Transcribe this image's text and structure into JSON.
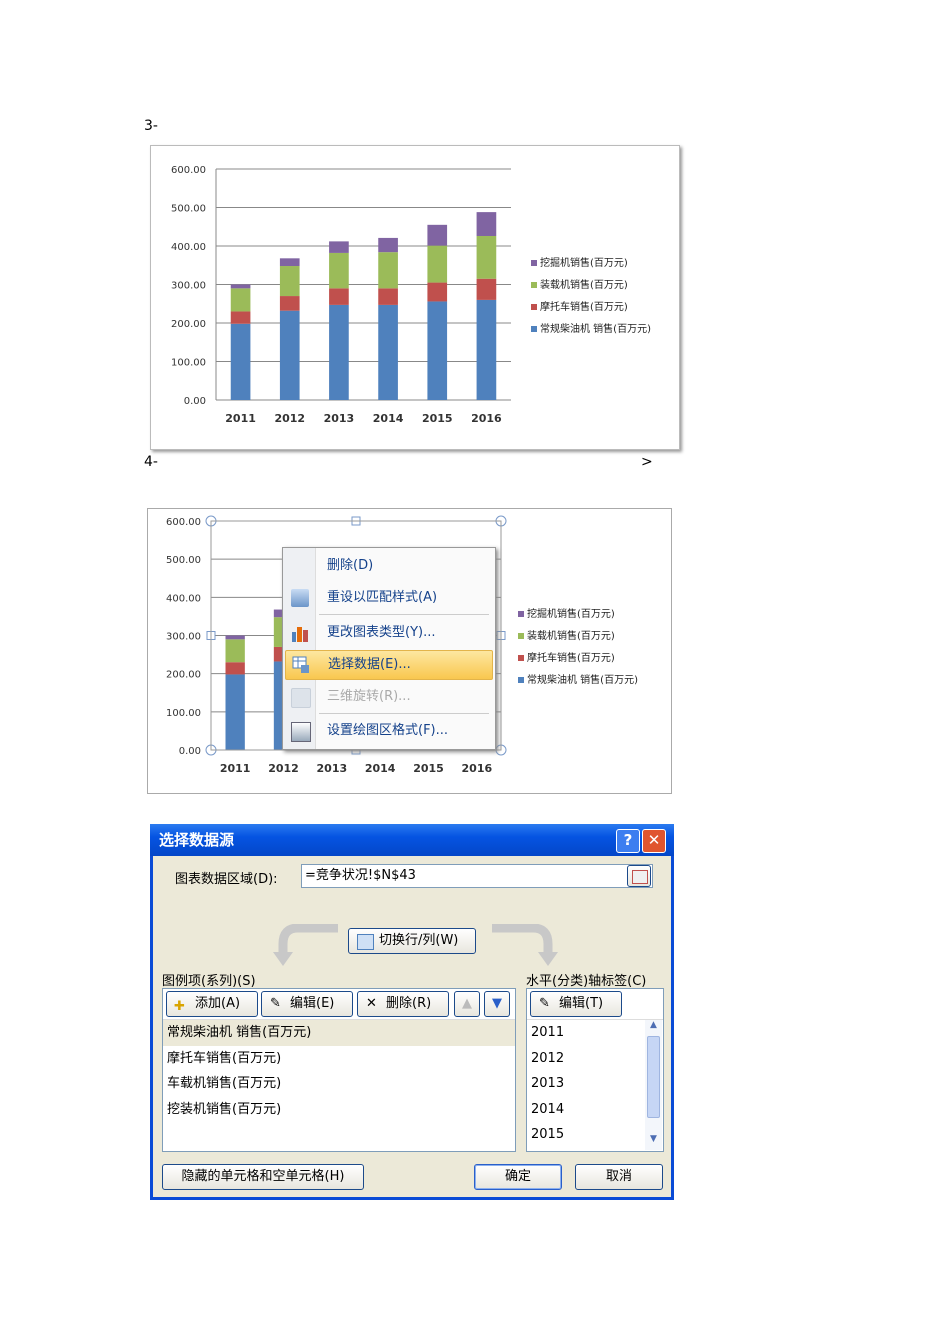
{
  "steps": {
    "s3": "3-",
    "s4": "4-",
    "s4_arrow": ">"
  },
  "colors": {
    "blue": "#4f81bd",
    "red": "#c0504d",
    "green": "#9bbb59",
    "purple": "#8064a2"
  },
  "chart_data": {
    "type": "bar",
    "stacked": true,
    "categories": [
      "2011",
      "2012",
      "2013",
      "2014",
      "2015",
      "2016"
    ],
    "ylim": [
      0,
      600
    ],
    "yticks": [
      "0.00",
      "100.00",
      "200.00",
      "300.00",
      "400.00",
      "500.00",
      "600.00"
    ],
    "grid": true,
    "legend": "right",
    "series": [
      {
        "name": "常规柴油机 销售(百万元)",
        "color": "#4f81bd",
        "values": [
          198,
          232,
          247,
          247,
          256,
          260
        ]
      },
      {
        "name": "摩托车销售(百万元)",
        "color": "#c0504d",
        "values": [
          32,
          38,
          43,
          43,
          49,
          55
        ]
      },
      {
        "name": "装载机销售(百万元)",
        "color": "#9bbb59",
        "values": [
          60,
          78,
          92,
          94,
          96,
          111
        ]
      },
      {
        "name": "挖掘机销售(百万元)",
        "color": "#8064a2",
        "values": [
          10,
          20,
          30,
          37,
          54,
          62
        ]
      }
    ]
  },
  "context_menu": {
    "items": [
      {
        "label": "删除(D)",
        "icon": "delete-icon"
      },
      {
        "label": "重设以匹配样式(A)",
        "icon": "reset-style-icon"
      },
      {
        "label": "更改图表类型(Y)...",
        "icon": "chart-type-icon"
      },
      {
        "label": "选择数据(E)...",
        "icon": "select-data-icon"
      },
      {
        "label": "三维旋转(R)...",
        "icon": "3d-rotate-icon"
      },
      {
        "label": "设置绘图区格式(F)...",
        "icon": "format-plot-icon"
      }
    ]
  },
  "dialog": {
    "title": "选择数据源",
    "help": "?",
    "close": "✕",
    "range_label": "图表数据区域(D):",
    "range_value": "=竞争状况!$N$43",
    "switch_label": "切换行/列(W)",
    "legend_label": "图例项(系列)(S)",
    "add": "添加(A)",
    "edit": "编辑(E)",
    "remove": "删除(R)",
    "series": [
      "常规柴油机 销售(百万元)",
      "摩托车销售(百万元)",
      "车载机销售(百万元)",
      "挖装机销售(百万元)"
    ],
    "axis_label": "水平(分类)轴标签(C)",
    "axis_edit": "编辑(T)",
    "categories": [
      "2011",
      "2012",
      "2013",
      "2014",
      "2015"
    ],
    "hidden_cells": "隐藏的单元格和空单元格(H)",
    "ok": "确定",
    "cancel": "取消"
  }
}
